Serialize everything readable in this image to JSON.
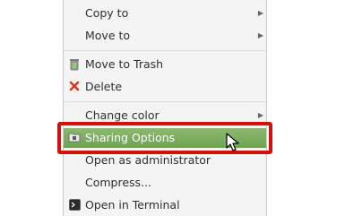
{
  "menu": {
    "items": [
      {
        "label": "Copy to",
        "icon": "",
        "submenu": true
      },
      {
        "label": "Move to",
        "icon": "",
        "submenu": true
      },
      {
        "label": "Move to Trash",
        "icon": "trash-icon",
        "submenu": false
      },
      {
        "label": "Delete",
        "icon": "delete-x-icon",
        "submenu": false
      },
      {
        "label": "Change color",
        "icon": "",
        "submenu": true
      },
      {
        "label": "Sharing Options",
        "icon": "sharing-folder-icon",
        "submenu": false,
        "highlighted": true
      },
      {
        "label": "Open as administrator",
        "icon": "",
        "submenu": false
      },
      {
        "label": "Compress...",
        "icon": "",
        "submenu": false
      },
      {
        "label": "Open in Terminal",
        "icon": "terminal-icon",
        "submenu": false
      }
    ],
    "submenu_arrow": "▶"
  },
  "colors": {
    "highlight": "#7aab5c",
    "annotation_box": "#d50e0e",
    "delete_icon": "#d23a1e"
  }
}
